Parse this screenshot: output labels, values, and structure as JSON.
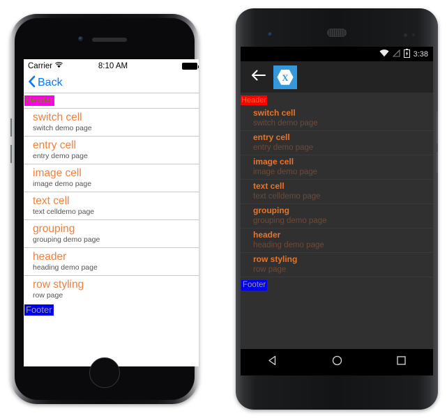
{
  "ios": {
    "status": {
      "carrier": "Carrier",
      "time": "8:10 AM",
      "wifi_icon": "wifi-icon",
      "battery_icon": "battery-icon"
    },
    "nav": {
      "back_label": "Back",
      "back_icon": "chevron-left-icon"
    },
    "list": {
      "header_label": "Header",
      "footer_label": "Footer",
      "rows": [
        {
          "title": "switch cell",
          "subtitle": "switch demo page"
        },
        {
          "title": "entry cell",
          "subtitle": "entry demo page"
        },
        {
          "title": "image cell",
          "subtitle": "image demo page"
        },
        {
          "title": "text cell",
          "subtitle": "text celldemo page"
        },
        {
          "title": "grouping",
          "subtitle": "grouping demo page"
        },
        {
          "title": "header",
          "subtitle": "heading demo page"
        },
        {
          "title": "row styling",
          "subtitle": "row page"
        }
      ]
    },
    "colors": {
      "title": "#f0803c",
      "subtitle": "#555555",
      "header_bg": "#ff00e7",
      "header_fg": "#7d7d1f",
      "footer_bg": "#0000f0",
      "footer_fg": "#9b9b9b",
      "tint": "#007aff"
    }
  },
  "android": {
    "status": {
      "time": "3:38",
      "wifi_icon": "wifi-icon",
      "signal_icon": "signal-icon",
      "battery_icon": "battery-charging-icon"
    },
    "appbar": {
      "back_icon": "arrow-left-icon",
      "logo_icon": "xamarin-logo-icon"
    },
    "list": {
      "header_label": "Header",
      "footer_label": "Footer",
      "rows": [
        {
          "title": "switch cell",
          "subtitle": "switch demo page"
        },
        {
          "title": "entry cell",
          "subtitle": "entry demo page"
        },
        {
          "title": "image cell",
          "subtitle": "image demo page"
        },
        {
          "title": "text cell",
          "subtitle": "text celldemo page"
        },
        {
          "title": "grouping",
          "subtitle": "grouping demo page"
        },
        {
          "title": "header",
          "subtitle": "heading demo page"
        },
        {
          "title": "row styling",
          "subtitle": "row page"
        }
      ]
    },
    "navbar": {
      "back_icon": "triangle-back-icon",
      "home_icon": "circle-home-icon",
      "recents_icon": "square-recents-icon"
    },
    "colors": {
      "title": "#e8742a",
      "subtitle": "#6d4a39",
      "header_bg": "#ff0000",
      "header_fg": "#f07030",
      "footer_bg": "#0000f0",
      "footer_fg": "#9b9b9b",
      "appbar_bg": "#232323",
      "page_bg": "#303030",
      "logo_bg": "#3498db"
    }
  }
}
